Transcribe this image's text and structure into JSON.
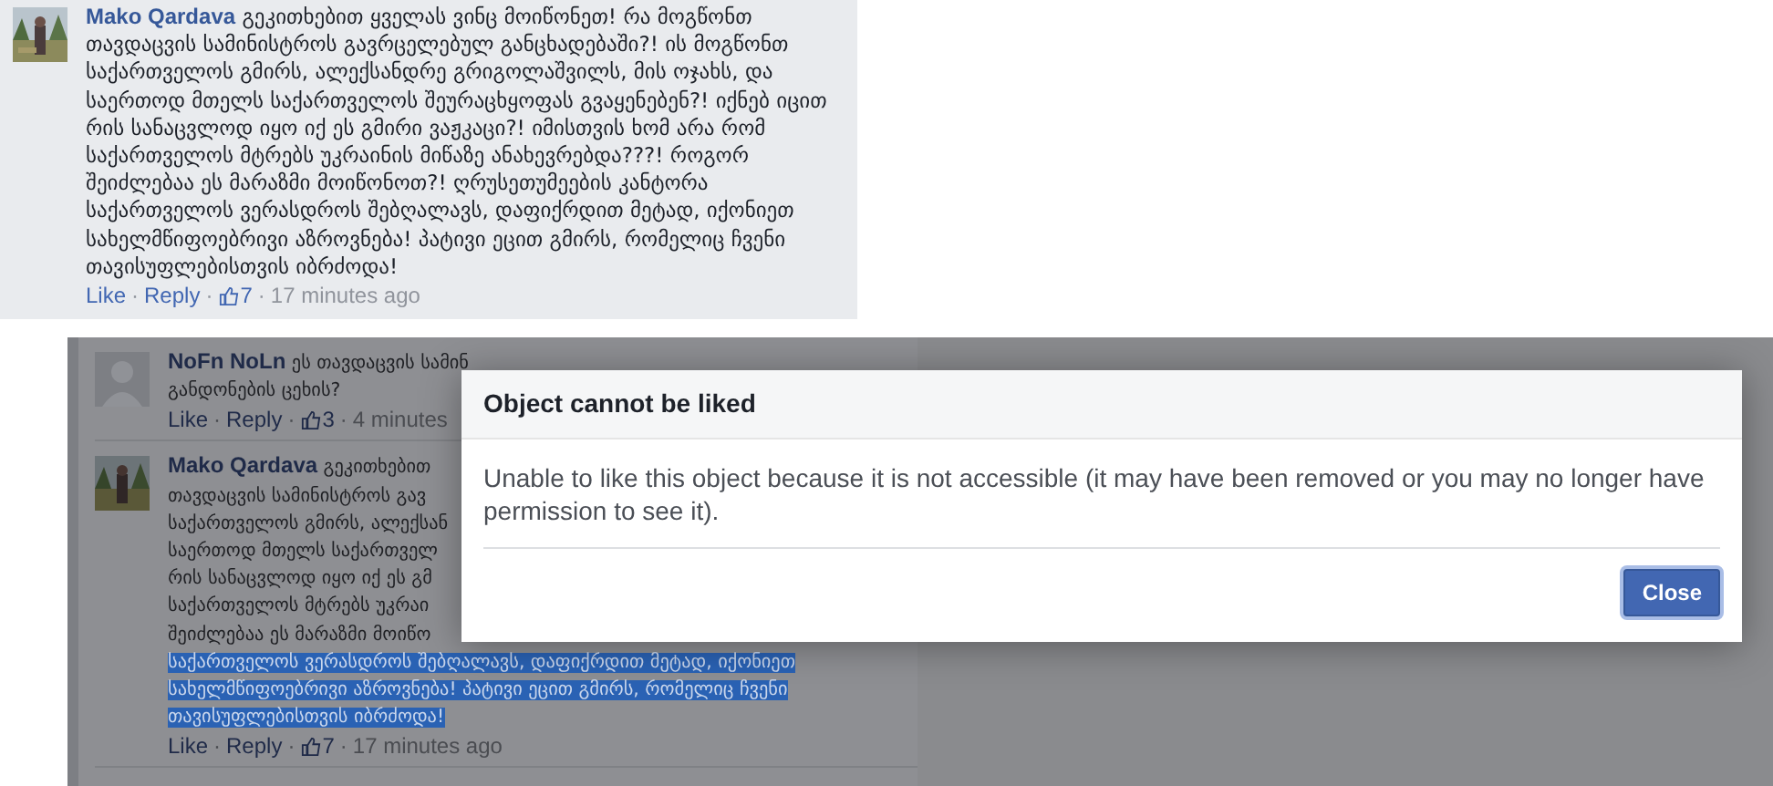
{
  "top_comment": {
    "author": "Mako Qardava",
    "lines": [
      {
        "text": "გეკითხებით ყველას ვინც მოიწონეთ! რა მოგწონთ",
        "selected": false
      },
      {
        "text": "თავდაცვის სამინისტროს გავრცელებულ განცხადებაში?! ის მოგწონთ",
        "selected": false
      },
      {
        "text": "საქართველოს გმირს, ალექსანდრე გრიგოლაშვილს, მის ოჯახს, და",
        "selected": false
      },
      {
        "text": "საერთოდ მთელს საქართველოს შეურაცხყოფას გვაყენებენ?! იქნებ იცით",
        "selected": false
      },
      {
        "text": "რის სანაცვლოდ იყო იქ ეს გმირი ვაჟკაცი?! იმისთვის ხომ არა რომ",
        "selected": false
      },
      {
        "text": "საქართველოს მტრებს უკრაინის მიწაზე ანახევრებდა???! როგორ",
        "selected": false
      },
      {
        "text": "შეიძლებაა ეს მარაზმი მოიწონოთ?! ღრუსეთუმეების კანტორა",
        "selected": false
      },
      {
        "text": "საქართველოს ვერასდროს შებღალავს, დაფიქრდით მეტად, იქონიეთ",
        "selected": false
      },
      {
        "text": "სახელმწიფოებრივი აზროვნება! პატივი ეცით გმირს, რომელიც ჩვენი",
        "selected": false
      },
      {
        "text": "თავისუფლებისთვის იბრძოდა!",
        "selected": false
      }
    ],
    "actions": [
      "Like",
      "Reply"
    ],
    "likes": "7",
    "time": "17 minutes ago"
  },
  "separator": "·",
  "background_comments": [
    {
      "author": "NoFn NoLn",
      "avatar": {
        "kind": "silhouette"
      },
      "lines": [
        {
          "text": "ეს თავდაცვის სამინ",
          "selected": false
        },
        {
          "text": "განდონების ცეხის?",
          "selected": false
        }
      ],
      "actions": [
        "Like",
        "Reply"
      ],
      "likes": "3",
      "time": "4 minutes"
    },
    {
      "author": "Mako Qardava",
      "lines": [
        {
          "text": "გეკითხებით",
          "selected": false
        },
        {
          "text": "თავდაცვის სამინისტროს გავ",
          "selected": false
        },
        {
          "text": "საქართველოს გმირს, ალექსან",
          "selected": false
        },
        {
          "text": "საერთოდ მთელს საქართველ",
          "selected": false
        },
        {
          "text": "რის სანაცვლოდ იყო იქ ეს გმ",
          "selected": false
        },
        {
          "text": "საქართველოს მტრებს უკრაი",
          "selected": false
        },
        {
          "text": "შეიძლებაა ეს მარაზმი მოიწო",
          "selected": false
        },
        {
          "text": "საქართველოს ვერასდროს შებღალავს, დაფიქრდით მეტად, იქონიეთ",
          "selected": true
        },
        {
          "text": "სახელმწიფოებრივი აზროვნება! პატივი ეცით გმირს, რომელიც ჩვენი",
          "selected": true
        },
        {
          "text": "თავისუფლებისთვის იბრძოდა!",
          "selected": true
        }
      ],
      "actions": [
        "Like",
        "Reply"
      ],
      "likes": "7",
      "time": "17 minutes ago"
    }
  ],
  "dialog": {
    "title": "Object cannot be liked",
    "message": "Unable to like this object because it is not accessible (it may have been removed or you may no longer have permission to see it).",
    "buttons": [
      "Close"
    ]
  }
}
